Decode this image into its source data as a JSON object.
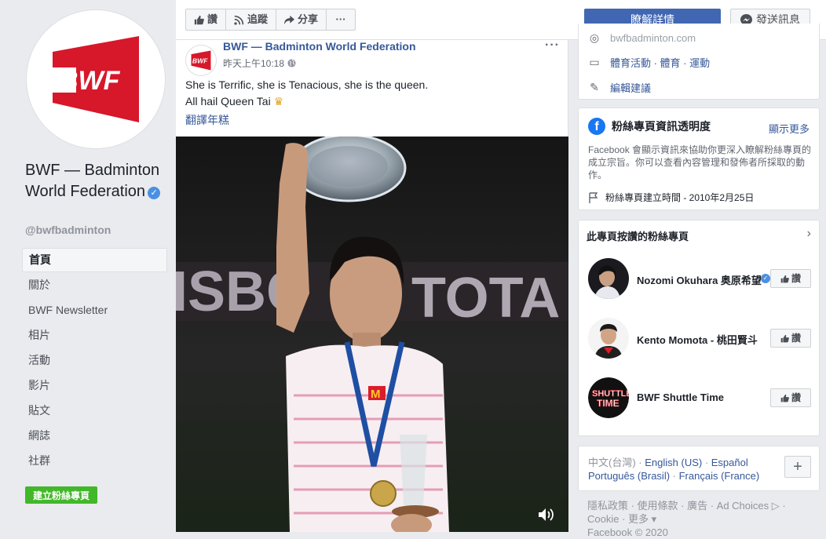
{
  "page": {
    "name": "BWF — Badminton World Federation",
    "handle": "@bwfbadminton",
    "logo_text": "BWF"
  },
  "nav": [
    {
      "label": "首頁",
      "active": true
    },
    {
      "label": "關於"
    },
    {
      "label": "BWF Newsletter"
    },
    {
      "label": "相片"
    },
    {
      "label": "活動"
    },
    {
      "label": "影片"
    },
    {
      "label": "貼文"
    },
    {
      "label": "網誌"
    },
    {
      "label": "社群"
    }
  ],
  "create_page_label": "建立粉絲專頁",
  "actionbar": {
    "like": "讚",
    "follow": "追蹤",
    "share": "分享",
    "more": "···",
    "learn_more": "瞭解詳情",
    "send_message": "發送訊息"
  },
  "post": {
    "author": "BWF — Badminton World Federation",
    "time": "昨天上午10:18",
    "text_line1": "She is Terrific, she is Tenacious, she is the queen.",
    "text_line2": "All hail Queen Tai",
    "translate": "翻譯年糕",
    "more": "···"
  },
  "about": {
    "website": "bwfbadminton.com",
    "category": "體育活動 · 體育 · 運動",
    "suggest_edit": "編輯建議"
  },
  "transparency": {
    "title": "粉絲專頁資訊透明度",
    "see_more": "顯示更多",
    "description": "Facebook 會顯示資訊來協助你更深入瞭解粉絲專頁的成立宗旨。你可以查看內容管理和發佈者所採取的動作。",
    "created": "粉絲專頁建立時間 - 2010年2月25日"
  },
  "liked_pages": {
    "title": "此專頁按讚的粉絲專頁",
    "items": [
      {
        "name": "Nozomi Okuhara 奥原希望",
        "verified": true,
        "button": "讚"
      },
      {
        "name": "Kento Momota - 桃田賢斗",
        "verified": false,
        "button": "讚"
      },
      {
        "name": "BWF Shuttle Time",
        "verified": false,
        "button": "讚"
      }
    ]
  },
  "languages": {
    "current": "中文(台灣)",
    "others": [
      "English (US)",
      "Español",
      "Português (Brasil)",
      "Français (France)"
    ],
    "add": "+"
  },
  "footer": {
    "line1": "隱私政策 · 使用條款 · 廣告 · Ad Choices ▷ ·",
    "line2": "Cookie · 更多 ▾",
    "line3": "Facebook © 2020"
  },
  "colors": {
    "brand_red": "#d7172a",
    "facebook_blue": "#4267b2",
    "link": "#365899",
    "green": "#42b72a"
  }
}
